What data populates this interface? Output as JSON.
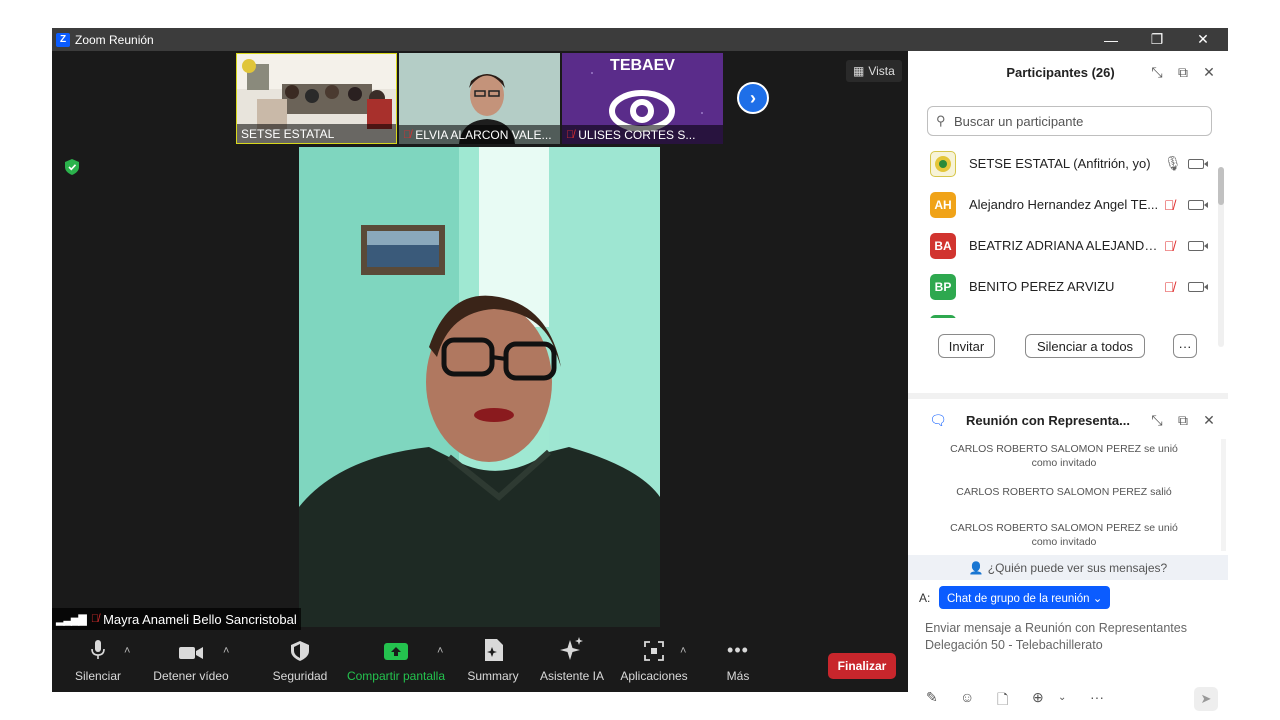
{
  "window": {
    "title": "Zoom Reunión",
    "logo": "Z"
  },
  "gallery": {
    "thumbs": [
      {
        "name": "SETSE ESTATAL",
        "muted": false
      },
      {
        "name": "ELVIA ALARCON VALE...",
        "muted": true
      },
      {
        "name": "ULISES CORTES S...",
        "muted": true,
        "logo_text": "TEBAEV"
      }
    ],
    "view_label": "Vista"
  },
  "active_speaker": {
    "name": "Mayra Anameli Bello Sancristobal"
  },
  "toolbar": {
    "mute": "Silenciar",
    "video": "Detener vídeo",
    "security": "Seguridad",
    "share": "Compartir pantalla",
    "summary": "Summary",
    "ai": "Asistente IA",
    "apps": "Aplicaciones",
    "more": "Más",
    "end": "Finalizar"
  },
  "participants": {
    "title": "Participantes (26)",
    "search_placeholder": "Buscar un participante",
    "list": [
      {
        "initials": "",
        "name": "SETSE ESTATAL (Anfitrión, yo)",
        "color": "#ffffff",
        "muted": false
      },
      {
        "initials": "AH",
        "name": "Alejandro Hernandez Angel TE...",
        "color": "#f0a318",
        "muted": true
      },
      {
        "initials": "BA",
        "name": "BEATRIZ ADRIANA ALEJANDRE",
        "color": "#d1342f",
        "muted": true
      },
      {
        "initials": "BP",
        "name": "BENITO PEREZ ARVIZU",
        "color": "#2ea84f",
        "muted": true
      }
    ],
    "invite": "Invitar",
    "mute_all": "Silenciar a todos",
    "more": "···"
  },
  "chat": {
    "title": "Reunión con Representa...",
    "messages": [
      "CARLOS ROBERTO SALOMON PEREZ se unió como invitado",
      "CARLOS ROBERTO SALOMON PEREZ salió",
      "CARLOS ROBERTO SALOMON PEREZ se unió como invitado"
    ],
    "who_can_see": "¿Quién puede ver sus mensajes?",
    "to_label": "A:",
    "to_value": "Chat de grupo de la reunión ⌄",
    "compose_placeholder": "Enviar mensaje a Reunión con Representantes Delegación 50 - Telebachillerato"
  }
}
